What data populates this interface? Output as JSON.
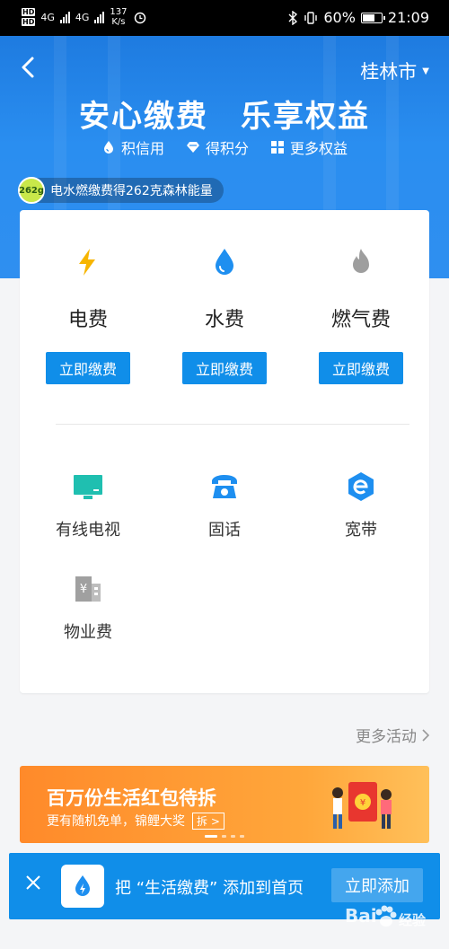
{
  "status_bar": {
    "hd_top": "HD",
    "hd_bottom": "HD",
    "net1": "4G",
    "net2": "4G",
    "speed_value": "137",
    "speed_unit": "K/s",
    "battery": "60%",
    "time": "21:09"
  },
  "header": {
    "city": "桂林市",
    "slogan": "安心缴费　乐享权益",
    "perks": [
      "积信用",
      "得积分",
      "更多权益"
    ],
    "energy_badge": "262g",
    "energy_text": "电水燃缴费得262克森林能量"
  },
  "utilities": [
    {
      "label": "电费",
      "button": "立即缴费",
      "icon": "lightning-icon",
      "color": "#f7b500"
    },
    {
      "label": "水费",
      "button": "立即缴费",
      "icon": "water-drop-icon",
      "color": "#1e8ff0"
    },
    {
      "label": "燃气费",
      "button": "立即缴费",
      "icon": "flame-icon",
      "color": "#9e9e9e"
    }
  ],
  "services": [
    {
      "label": "有线电视",
      "icon": "tv-icon",
      "color": "#1fbfb0"
    },
    {
      "label": "固话",
      "icon": "telephone-icon",
      "color": "#1e8ff0"
    },
    {
      "label": "宽带",
      "icon": "broadband-icon",
      "color": "#1e8ff0"
    },
    {
      "label": "物业费",
      "icon": "property-icon",
      "color": "#a0a0a0"
    }
  ],
  "more_activities": "更多活动",
  "banner": {
    "title": "百万份生活红包待拆",
    "subtitle": "更有随机免单，锦鲤大奖",
    "tag": "拆 >"
  },
  "add_bar": {
    "text": "把 “生活缴费” 添加到首页",
    "button": "立即添加"
  },
  "watermark": {
    "text1": "Bai",
    "text2": "经验"
  },
  "colors": {
    "primary": "#108ee9",
    "hero": "#2a8ef0",
    "banner": "#ff8a2a"
  }
}
